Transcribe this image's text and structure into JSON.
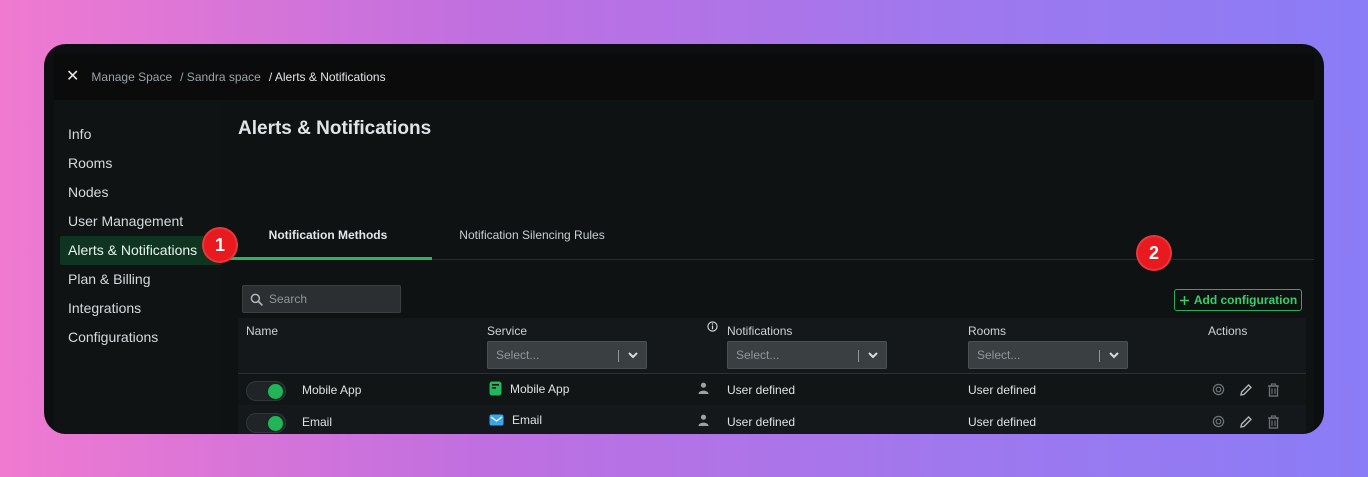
{
  "breadcrumb": {
    "close_icon": "close-icon",
    "items": [
      "Manage Space",
      "/ Sandra space",
      "/ Alerts & Notifications"
    ]
  },
  "sidebar": {
    "items": [
      {
        "label": "Info",
        "active": false
      },
      {
        "label": "Rooms",
        "active": false
      },
      {
        "label": "Nodes",
        "active": false
      },
      {
        "label": "User Management",
        "active": false
      },
      {
        "label": "Alerts & Notifications",
        "active": true
      },
      {
        "label": "Plan & Billing",
        "active": false
      },
      {
        "label": "Integrations",
        "active": false
      },
      {
        "label": "Configurations",
        "active": false
      }
    ]
  },
  "page": {
    "title": "Alerts & Notifications",
    "tabs": [
      {
        "label": "Notification Methods",
        "active": true
      },
      {
        "label": "Notification Silencing Rules",
        "active": false
      }
    ],
    "search_placeholder": "Search",
    "add_label": "Add configuration"
  },
  "badges": [
    "1",
    "2"
  ],
  "table": {
    "columns": {
      "name": "Name",
      "service": "Service",
      "notifications": "Notifications",
      "rooms": "Rooms",
      "actions": "Actions"
    },
    "filter_placeholder": "Select...",
    "rows": [
      {
        "name": "Mobile App",
        "service": "Mobile App",
        "service_icon": "mobile-app-icon",
        "notifications": "User defined",
        "rooms": "User defined",
        "enabled": true
      },
      {
        "name": "Email",
        "service": "Email",
        "service_icon": "email-icon",
        "notifications": "User defined",
        "rooms": "User defined",
        "enabled": true
      }
    ]
  },
  "colors": {
    "accent": "#28b85a",
    "badge": "#e8191f",
    "active_nav_bg": "#0f3420"
  }
}
